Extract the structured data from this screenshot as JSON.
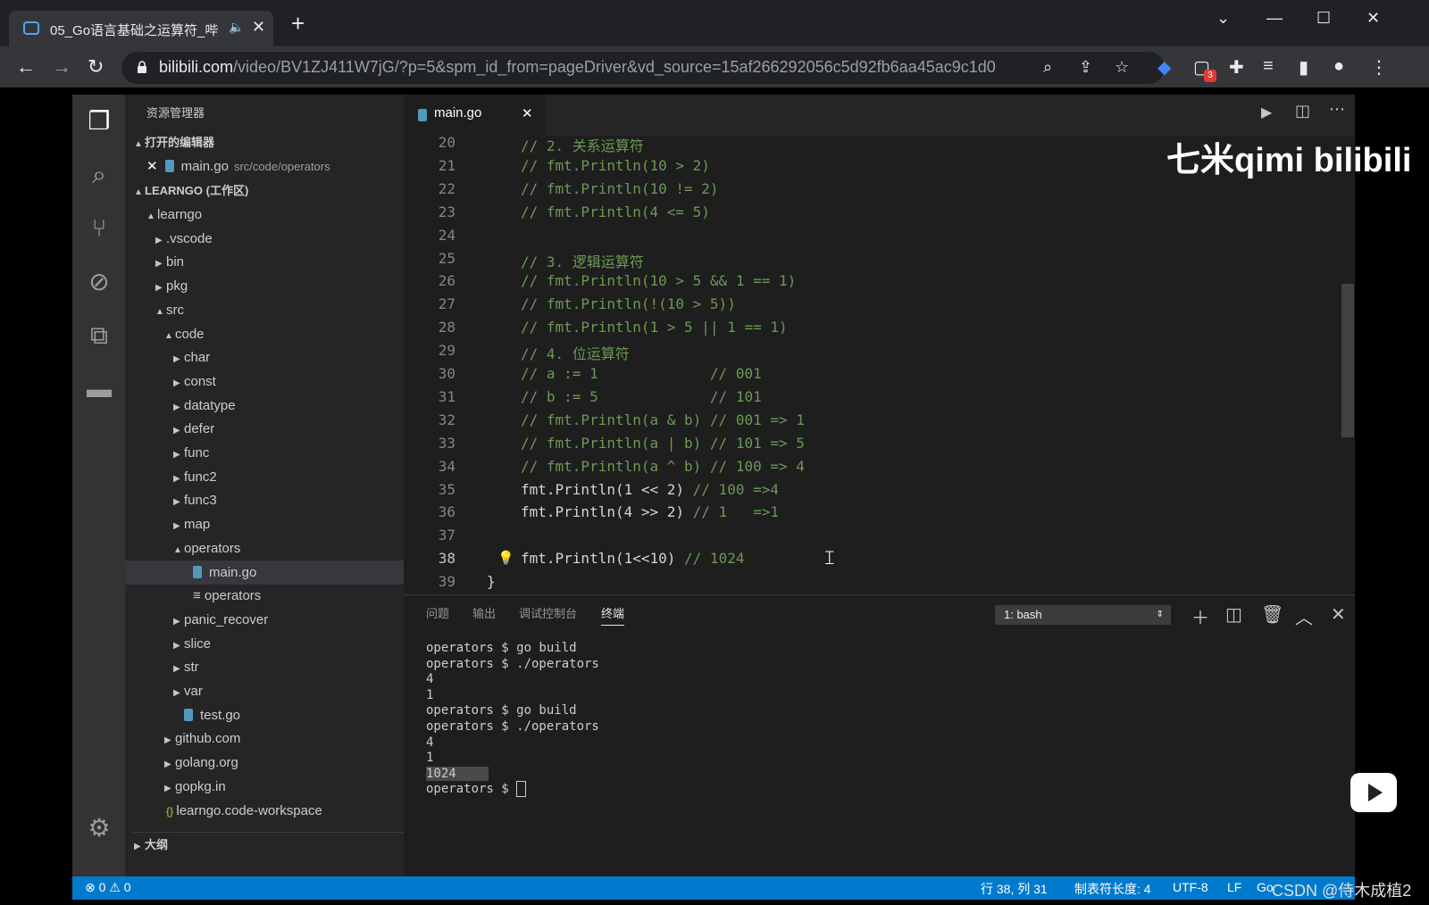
{
  "browser": {
    "tab_title": "05_Go语言基础之运算符_哔",
    "new_tab": "+",
    "url_host": "bilibili.com",
    "url_path": "/video/BV1ZJ411W7jG/?p=5&spm_id_from=pageDriver&vd_source=15af266292056c5d92fb6aa45ac9c1d0",
    "badge_count": "3"
  },
  "explorer": {
    "title": "资源管理器",
    "open_editors": "打开的编辑器",
    "open_file": "main.go",
    "open_file_path": "src/code/operators",
    "workspace": "LEARNGO (工作区)",
    "tree": [
      {
        "label": "learngo",
        "depth": 0,
        "arrow": "▲"
      },
      {
        "label": ".vscode",
        "depth": 1,
        "arrow": "▶"
      },
      {
        "label": "bin",
        "depth": 1,
        "arrow": "▶"
      },
      {
        "label": "pkg",
        "depth": 1,
        "arrow": "▶"
      },
      {
        "label": "src",
        "depth": 1,
        "arrow": "▲"
      },
      {
        "label": "code",
        "depth": 2,
        "arrow": "▲"
      },
      {
        "label": "char",
        "depth": 3,
        "arrow": "▶"
      },
      {
        "label": "const",
        "depth": 3,
        "arrow": "▶"
      },
      {
        "label": "datatype",
        "depth": 3,
        "arrow": "▶"
      },
      {
        "label": "defer",
        "depth": 3,
        "arrow": "▶"
      },
      {
        "label": "func",
        "depth": 3,
        "arrow": "▶"
      },
      {
        "label": "func2",
        "depth": 3,
        "arrow": "▶"
      },
      {
        "label": "func3",
        "depth": 3,
        "arrow": "▶"
      },
      {
        "label": "map",
        "depth": 3,
        "arrow": "▶"
      },
      {
        "label": "operators",
        "depth": 3,
        "arrow": "▲"
      },
      {
        "label": "main.go",
        "depth": 4,
        "arrow": "",
        "icon": "go"
      },
      {
        "label": "operators",
        "depth": 4,
        "arrow": "",
        "icon": "lines"
      },
      {
        "label": "panic_recover",
        "depth": 3,
        "arrow": "▶"
      },
      {
        "label": "slice",
        "depth": 3,
        "arrow": "▶"
      },
      {
        "label": "str",
        "depth": 3,
        "arrow": "▶"
      },
      {
        "label": "var",
        "depth": 3,
        "arrow": "▶"
      },
      {
        "label": "test.go",
        "depth": 3,
        "arrow": "",
        "icon": "go"
      },
      {
        "label": "github.com",
        "depth": 2,
        "arrow": "▶"
      },
      {
        "label": "golang.org",
        "depth": 2,
        "arrow": "▶"
      },
      {
        "label": "gopkg.in",
        "depth": 2,
        "arrow": "▶"
      },
      {
        "label": "learngo.code-workspace",
        "depth": 1,
        "arrow": "",
        "icon": "braces"
      }
    ],
    "outline": "大纲"
  },
  "editor": {
    "tab_label": "main.go",
    "lines": [
      {
        "n": "20",
        "code": "// 2. 关系运算符",
        "comment": true
      },
      {
        "n": "21",
        "code": "// fmt.Println(10 > 2)",
        "comment": true
      },
      {
        "n": "22",
        "code": "// fmt.Println(10 != 2)",
        "comment": true
      },
      {
        "n": "23",
        "code": "// fmt.Println(4 <= 5)",
        "comment": true
      },
      {
        "n": "24",
        "code": "",
        "comment": false
      },
      {
        "n": "25",
        "code": "// 3. 逻辑运算符",
        "comment": true
      },
      {
        "n": "26",
        "code": "// fmt.Println(10 > 5 && 1 == 1)",
        "comment": true
      },
      {
        "n": "27",
        "code": "// fmt.Println(!(10 > 5))",
        "comment": true
      },
      {
        "n": "28",
        "code": "// fmt.Println(1 > 5 || 1 == 1)",
        "comment": true
      },
      {
        "n": "29",
        "code": "// 4. 位运算符",
        "comment": true
      },
      {
        "n": "30",
        "code": "// a := 1             // 001",
        "comment": true
      },
      {
        "n": "31",
        "code": "// b := 5             // 101",
        "comment": true
      },
      {
        "n": "32",
        "code": "// fmt.Println(a & b) // 001 => 1",
        "comment": true
      },
      {
        "n": "33",
        "code": "// fmt.Println(a | b) // 101 => 5",
        "comment": true
      },
      {
        "n": "34",
        "code": "// fmt.Println(a ^ b) // 100 => 4",
        "comment": true
      },
      {
        "n": "35",
        "code": "fmt.Println(1 << 2) ",
        "tail": "// 100 =>4"
      },
      {
        "n": "36",
        "code": "fmt.Println(4 >> 2) ",
        "tail": "// 1   =>1"
      },
      {
        "n": "37",
        "code": "",
        "comment": false
      },
      {
        "n": "38",
        "code": "fmt.Println(1<<10) ",
        "tail": "// 1024"
      },
      {
        "n": "39",
        "code": "}",
        "comment": false,
        "indent": "left"
      }
    ]
  },
  "panel": {
    "tabs": [
      "问题",
      "输出",
      "调试控制台",
      "终端"
    ],
    "active_tab": "终端",
    "terminal_select": "1: bash",
    "terminal": [
      "operators $ go build",
      "operators $ ./operators",
      "4",
      "1",
      "operators $ go build",
      "operators $ ./operators",
      "4",
      "1",
      "1024",
      "operators $ "
    ]
  },
  "status": {
    "errors": "0",
    "warnings": "0",
    "position": "行 38, 列 31",
    "tab_size": "制表符长度: 4",
    "encoding": "UTF-8",
    "eol": "LF",
    "language": "Go"
  },
  "overlay": {
    "watermark": "七米qimi bilibili",
    "csdn": "CSDN @侍木成植2"
  },
  "colors": {
    "statusbar": "#007acc",
    "comment": "#6a9955",
    "activity": "#333333",
    "sidebar": "#252526",
    "editor": "#1e1e1e"
  }
}
